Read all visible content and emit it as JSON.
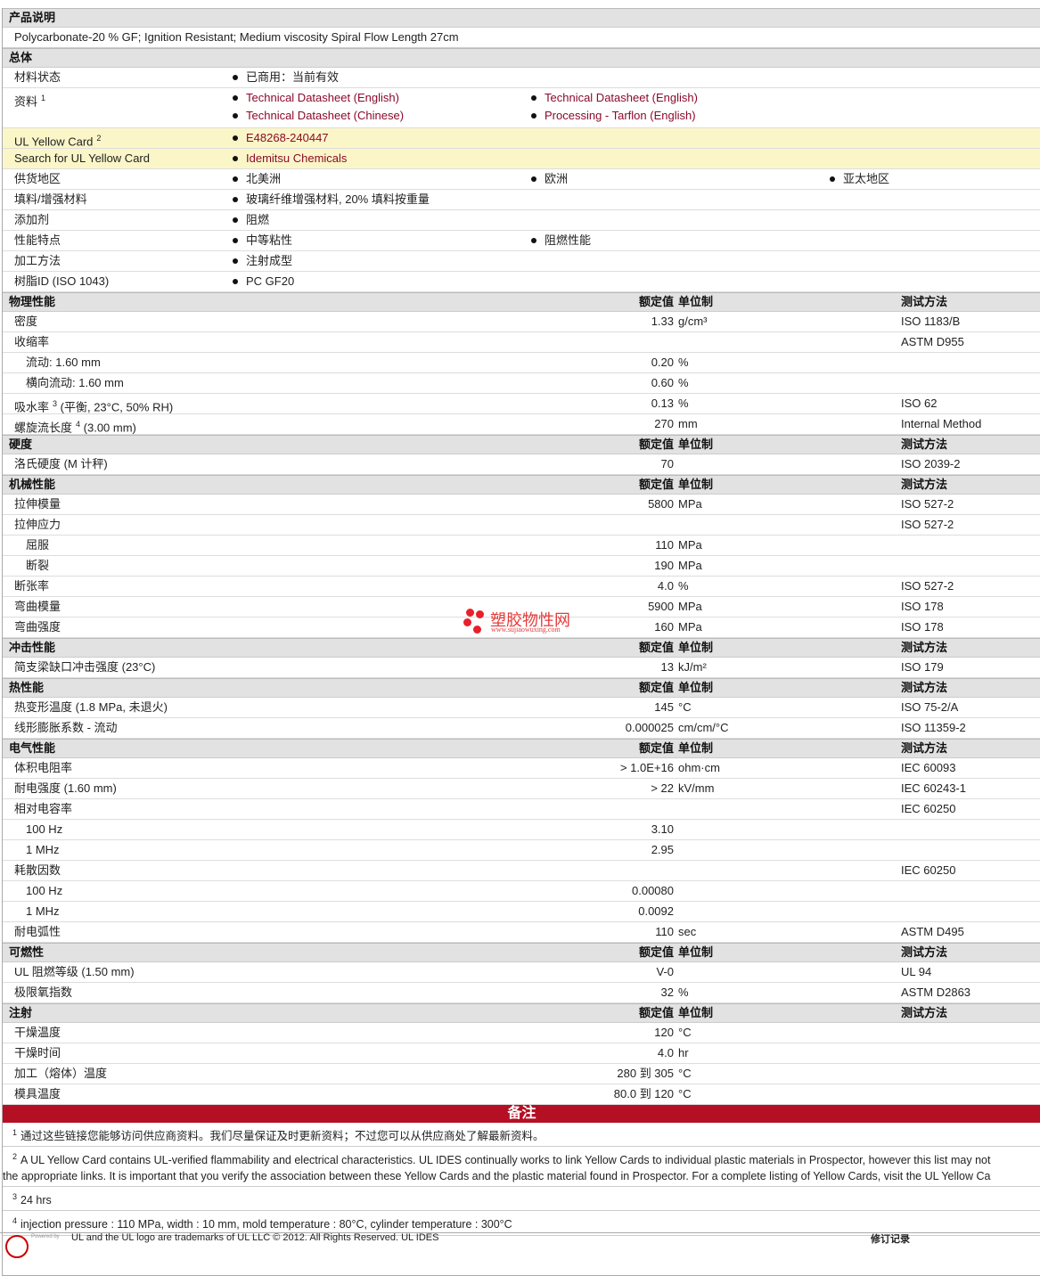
{
  "product_description": {
    "title": "产品说明",
    "text": "Polycarbonate-20 % GF; Ignition Resistant; Medium viscosity Spiral Flow Length 27cm"
  },
  "general": {
    "title": "总体",
    "rows": [
      {
        "label": "材料状态",
        "items": [
          "已商用：当前有效"
        ]
      },
      {
        "label": "资料",
        "sup": "1",
        "items": [
          "Technical Datasheet (English)",
          "Technical Datasheet (English)",
          "Technical Datasheet (Chinese)",
          "Processing - Tarflon (English)"
        ],
        "links": true
      },
      {
        "label": "UL Yellow Card",
        "sup": "2",
        "items": [
          "E48268-240447"
        ],
        "links": true,
        "yellow": true
      },
      {
        "label": "Search for UL Yellow Card",
        "items": [
          "Idemitsu Chemicals"
        ],
        "links": true,
        "yellow": true
      },
      {
        "label": "供货地区",
        "items": [
          "北美洲",
          "欧洲",
          "亚太地区"
        ]
      },
      {
        "label": "填料/增强材料",
        "items": [
          "玻璃纤维增强材料, 20% 填料按重量"
        ]
      },
      {
        "label": "添加剂",
        "items": [
          "阻燃"
        ]
      },
      {
        "label": "性能特点",
        "items": [
          "中等粘性",
          "阻燃性能"
        ]
      },
      {
        "label": "加工方法",
        "items": [
          "注射成型"
        ]
      },
      {
        "label": "树脂ID (ISO 1043)",
        "items": [
          "PC GF20"
        ]
      }
    ]
  },
  "col_headers": {
    "value": "额定值",
    "unit": "单位制",
    "method": "测试方法"
  },
  "sections": [
    {
      "title": "物理性能",
      "rows": [
        {
          "label": "密度",
          "value": "1.33",
          "unit": "g/cm³",
          "method": "ISO 1183/B"
        },
        {
          "label": "收缩率",
          "value": "",
          "unit": "",
          "method": "ASTM D955"
        },
        {
          "label": "流动: 1.60 mm",
          "sub": true,
          "value": "0.20",
          "unit": "%",
          "method": ""
        },
        {
          "label": "横向流动: 1.60 mm",
          "sub": true,
          "value": "0.60",
          "unit": "%",
          "method": ""
        },
        {
          "label": "吸水率",
          "sup": "3",
          "suffix": " (平衡, 23°C, 50% RH)",
          "value": "0.13",
          "unit": "%",
          "method": "ISO 62"
        },
        {
          "label": "螺旋流长度",
          "sup": "4",
          "suffix": " (3.00 mm)",
          "value": "270",
          "unit": "mm",
          "method": "Internal Method"
        }
      ]
    },
    {
      "title": "硬度",
      "rows": [
        {
          "label": "洛氏硬度  (M 计秤)",
          "value": "70",
          "unit": "",
          "method": "ISO 2039-2"
        }
      ]
    },
    {
      "title": "机械性能",
      "rows": [
        {
          "label": "拉伸模量",
          "value": "5800",
          "unit": "MPa",
          "method": "ISO 527-2"
        },
        {
          "label": "拉伸应力",
          "value": "",
          "unit": "",
          "method": "ISO 527-2"
        },
        {
          "label": "屈服",
          "sub": true,
          "value": "110",
          "unit": "MPa",
          "method": ""
        },
        {
          "label": "断裂",
          "sub": true,
          "value": "190",
          "unit": "MPa",
          "method": ""
        },
        {
          "label": "断张率",
          "value": "4.0",
          "unit": "%",
          "method": "ISO 527-2"
        },
        {
          "label": "弯曲模量",
          "value": "5900",
          "unit": "MPa",
          "method": "ISO 178"
        },
        {
          "label": "弯曲强度",
          "value": "160",
          "unit": "MPa",
          "method": "ISO 178"
        }
      ]
    },
    {
      "title": "冲击性能",
      "rows": [
        {
          "label": "简支梁缺口冲击强度  (23°C)",
          "value": "13",
          "unit": "kJ/m²",
          "method": "ISO 179"
        }
      ]
    },
    {
      "title": "热性能",
      "rows": [
        {
          "label": "热变形温度  (1.8 MPa, 未退火)",
          "value": "145",
          "unit": "°C",
          "method": "ISO 75-2/A"
        },
        {
          "label": "线形膨胀系数  - 流动",
          "value": "0.000025",
          "unit": "cm/cm/°C",
          "method": "ISO 11359-2"
        }
      ]
    },
    {
      "title": "电气性能",
      "rows": [
        {
          "label": "体积电阻率",
          "value": "> 1.0E+16",
          "unit": "ohm·cm",
          "method": "IEC 60093"
        },
        {
          "label": "耐电强度  (1.60 mm)",
          "value": "> 22",
          "unit": "kV/mm",
          "method": "IEC 60243-1"
        },
        {
          "label": "相对电容率",
          "value": "",
          "unit": "",
          "method": "IEC 60250"
        },
        {
          "label": "100 Hz",
          "sub": true,
          "value": "3.10",
          "unit": "",
          "method": ""
        },
        {
          "label": "1 MHz",
          "sub": true,
          "value": "2.95",
          "unit": "",
          "method": ""
        },
        {
          "label": "耗散因数",
          "value": "",
          "unit": "",
          "method": "IEC 60250"
        },
        {
          "label": "100 Hz",
          "sub": true,
          "value": "0.00080",
          "unit": "",
          "method": ""
        },
        {
          "label": "1 MHz",
          "sub": true,
          "value": "0.0092",
          "unit": "",
          "method": ""
        },
        {
          "label": "耐电弧性",
          "value": "110",
          "unit": "sec",
          "method": "ASTM D495"
        }
      ]
    },
    {
      "title": "可燃性",
      "rows": [
        {
          "label": "UL 阻燃等级  (1.50 mm)",
          "value": "V-0",
          "unit": "",
          "method": "UL 94"
        },
        {
          "label": "极限氧指数",
          "value": "32",
          "unit": "%",
          "method": "ASTM D2863"
        }
      ]
    },
    {
      "title": "注射",
      "rows": [
        {
          "label": "干燥温度",
          "value": "120",
          "unit": "°C",
          "method": ""
        },
        {
          "label": "干燥时间",
          "value": "4.0",
          "unit": "hr",
          "method": ""
        },
        {
          "label": "加工（熔体）温度",
          "value": "280 到  305",
          "unit": "°C",
          "method": ""
        },
        {
          "label": "模具温度",
          "value": "80.0 到  120",
          "unit": "°C",
          "method": ""
        }
      ]
    }
  ],
  "notes": {
    "title": "备注",
    "items": [
      {
        "num": "1",
        "text": "通过这些链接您能够访问供应商资料。我们尽量保证及时更新资料；不过您可以从供应商处了解最新资料。"
      },
      {
        "num": "2",
        "text": "A UL Yellow Card contains UL-verified flammability and electrical characteristics. UL IDES continually works to link Yellow Cards to individual plastic materials in Prospector, however this list may not",
        "text2": "the appropriate links. It is important that you verify the association between these Yellow Cards and the plastic material found in Prospector. For a complete listing of Yellow Cards, visit the UL Yellow Ca"
      },
      {
        "num": "3",
        "text": "24 hrs"
      },
      {
        "num": "4",
        "text": "injection pressure : 110 MPa, width : 10 mm, mold temperature : 80°C, cylinder temperature : 300°C"
      }
    ]
  },
  "watermark": {
    "name": "塑胶物性网",
    "url": "www.sujiaowuxing.com"
  },
  "footer": {
    "powered": "Powered by",
    "text": "UL and the UL logo are trademarks of UL LLC © 2012. All Rights Reserved. UL IDES",
    "revision": "修订记录"
  }
}
